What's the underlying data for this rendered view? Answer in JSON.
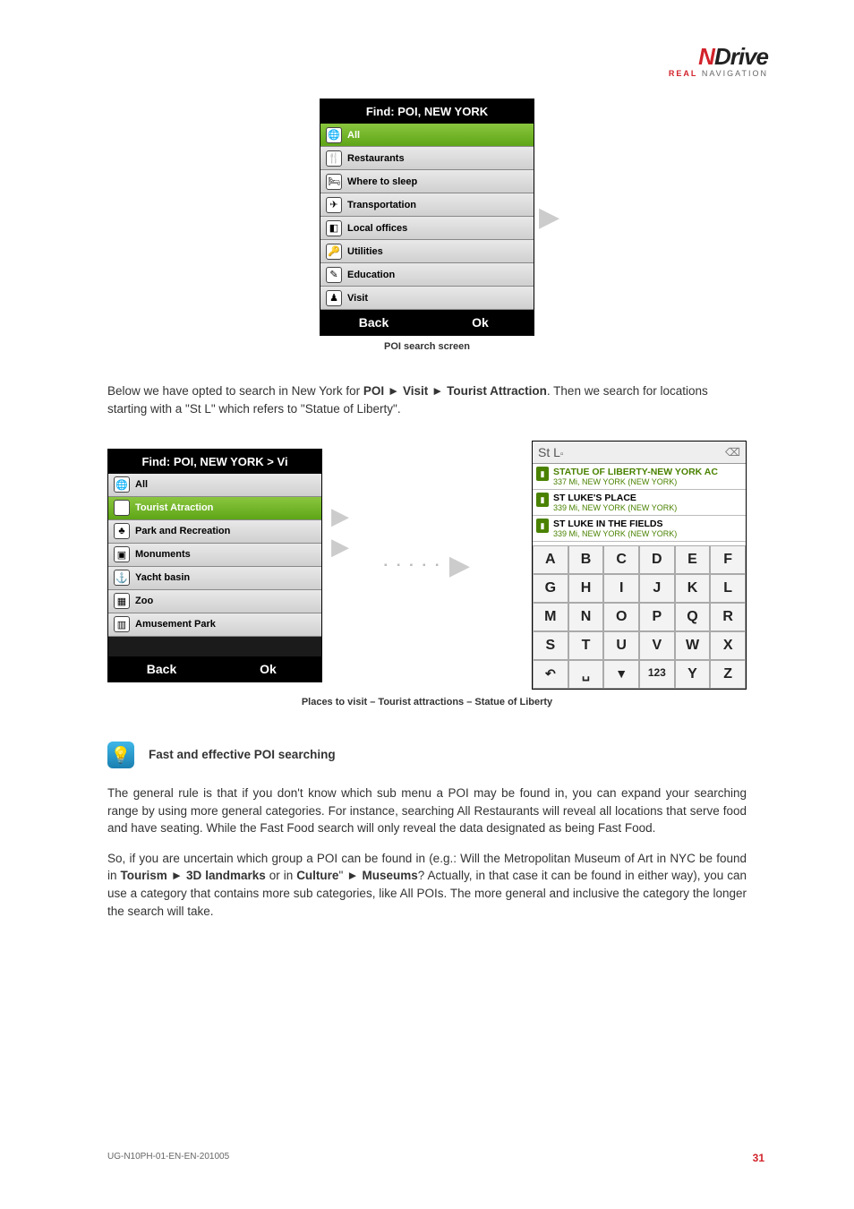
{
  "logo": {
    "brand_n": "N",
    "brand_rest": "Drive",
    "tag_real": "REAL",
    "tag_nav": " NAVIGATION"
  },
  "shot1": {
    "title": "Find: POI, NEW YORK",
    "rows": [
      {
        "label": "All",
        "icon": "🌐",
        "sel": true
      },
      {
        "label": "Restaurants",
        "icon": "🍴"
      },
      {
        "label": "Where to sleep",
        "icon": "🛏"
      },
      {
        "label": "Transportation",
        "icon": "✈"
      },
      {
        "label": "Local offices",
        "icon": "◧"
      },
      {
        "label": "Utilities",
        "icon": "🔑"
      },
      {
        "label": "Education",
        "icon": "✎"
      },
      {
        "label": "Visit",
        "icon": "♟"
      }
    ],
    "back": "Back",
    "ok": "Ok",
    "caption": "POI search screen"
  },
  "para1": {
    "pre": "Below we have opted to search in New York for ",
    "b1": "POI ► Visit ► Tourist Attraction",
    "mid": ". Then we search for locations starting with a \"St L\" which refers to \"Statue of Liberty\"."
  },
  "shot2": {
    "title": "Find: POI, NEW YORK > Vi",
    "rows": [
      {
        "label": "All",
        "icon": "🌐"
      },
      {
        "label": "Tourist Atraction",
        "icon": "▣",
        "sel": true
      },
      {
        "label": "Park and Recreation",
        "icon": "♣"
      },
      {
        "label": "Monuments",
        "icon": "▣"
      },
      {
        "label": "Yacht basin",
        "icon": "⚓"
      },
      {
        "label": "Zoo",
        "icon": "▦"
      },
      {
        "label": "Amusement Park",
        "icon": "▥"
      }
    ],
    "back": "Back",
    "ok": "Ok"
  },
  "dots": "▪ ▪ ▪ ▪ ▪",
  "shot3": {
    "input": "St L",
    "inputcursor": "▫",
    "delicon": "⌫",
    "results": [
      {
        "t1": "STATUE OF LIBERTY-NEW YORK AC",
        "t2": "337 Mi, NEW YORK (NEW YORK)",
        "green": true
      },
      {
        "t1": "ST LUKE'S PLACE",
        "t2": "339 Mi, NEW YORK (NEW YORK)"
      },
      {
        "t1": "ST LUKE IN THE FIELDS",
        "t2": "339 Mi, NEW YORK (NEW YORK)"
      }
    ],
    "keys": [
      "A",
      "B",
      "C",
      "D",
      "E",
      "F",
      "G",
      "H",
      "I",
      "J",
      "K",
      "L",
      "M",
      "N",
      "O",
      "P",
      "Q",
      "R",
      "S",
      "T",
      "U",
      "V",
      "W",
      "X",
      "↶",
      "␣",
      "▼",
      "123",
      "Y",
      "Z"
    ]
  },
  "caption2": "Places to visit – Tourist attractions – Statue of Liberty",
  "tip": {
    "head": "Fast and effective POI searching",
    "p1": "The general rule is that if you don't know which sub menu a POI may be found in, you can expand your searching range by using more general categories. For instance, searching All Restaurants will reveal all locations that serve food and have seating. While the Fast Food search will only reveal the data designated as being Fast Food.",
    "p2a": "So, if you are uncertain which group a POI can be found in (e.g.: Will the Metropolitan Museum of Art in NYC be found in ",
    "p2b": "Tourism ► 3D landmarks",
    "p2c": " or in ",
    "p2d": "Culture",
    "p2e": "\" ► ",
    "p2f": "Museums",
    "p2g": "? Actually, in that case it can be found in either way), you can use a category that contains more sub categories, like All POIs. The more general and inclusive the category the longer the search will take."
  },
  "footer": {
    "code": "UG-N10PH-01-EN-EN-201005",
    "page": "31"
  }
}
